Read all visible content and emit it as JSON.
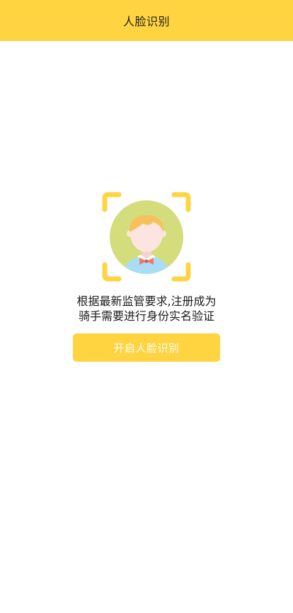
{
  "header": {
    "title": "人脸识别"
  },
  "notice": {
    "line1": "根据最新监管要求,注册成为",
    "line2": "骑手需要进行身份实名验证"
  },
  "action": {
    "start_label": "开启人脸识别"
  },
  "icons": {
    "illustration": "face-scan-icon"
  },
  "colors": {
    "accent": "#FFD440",
    "avatar_bg": "#D4DD7C",
    "shirt": "#A8DDF5",
    "hair": "#F6C15B",
    "bowtie": "#F0776B",
    "skin": "#FCE4E0"
  }
}
